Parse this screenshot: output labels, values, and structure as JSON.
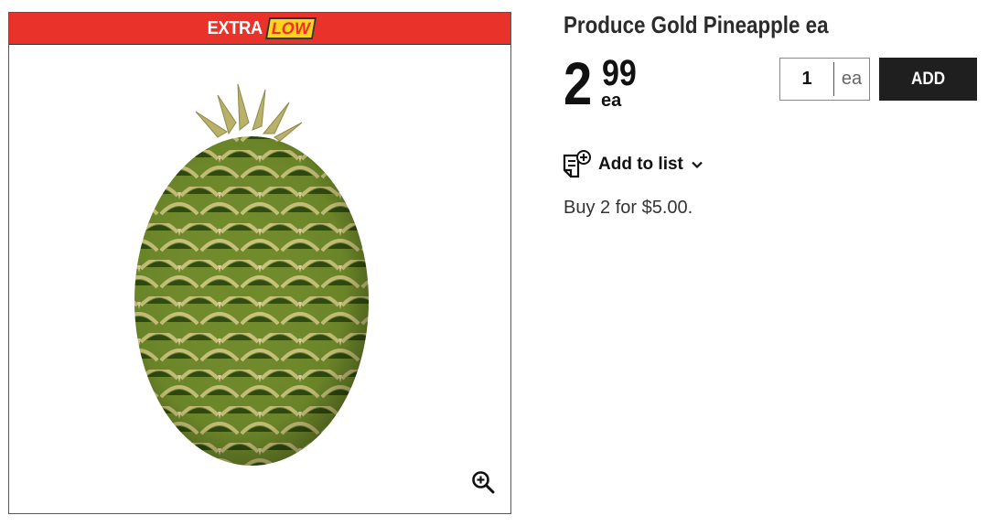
{
  "promo": {
    "label": "EXTRA",
    "tag": "LOW",
    "banner_color": "#e8322a",
    "tag_color": "#ffd21f"
  },
  "image": {
    "alt": "Produce Gold Pineapple ea",
    "zoom_icon": "zoom-in-icon"
  },
  "product": {
    "title": "Produce Gold Pineapple ea",
    "price_dollars": "2",
    "price_cents": "99",
    "price_unit": "ea",
    "offer": "Buy 2 for $5.00."
  },
  "quantity": {
    "value": "1",
    "unit": "ea"
  },
  "actions": {
    "add_label": "ADD",
    "add_to_list_label": "Add to list",
    "list_icon": "add-to-list-icon",
    "chevron_icon": "chevron-down-icon"
  }
}
